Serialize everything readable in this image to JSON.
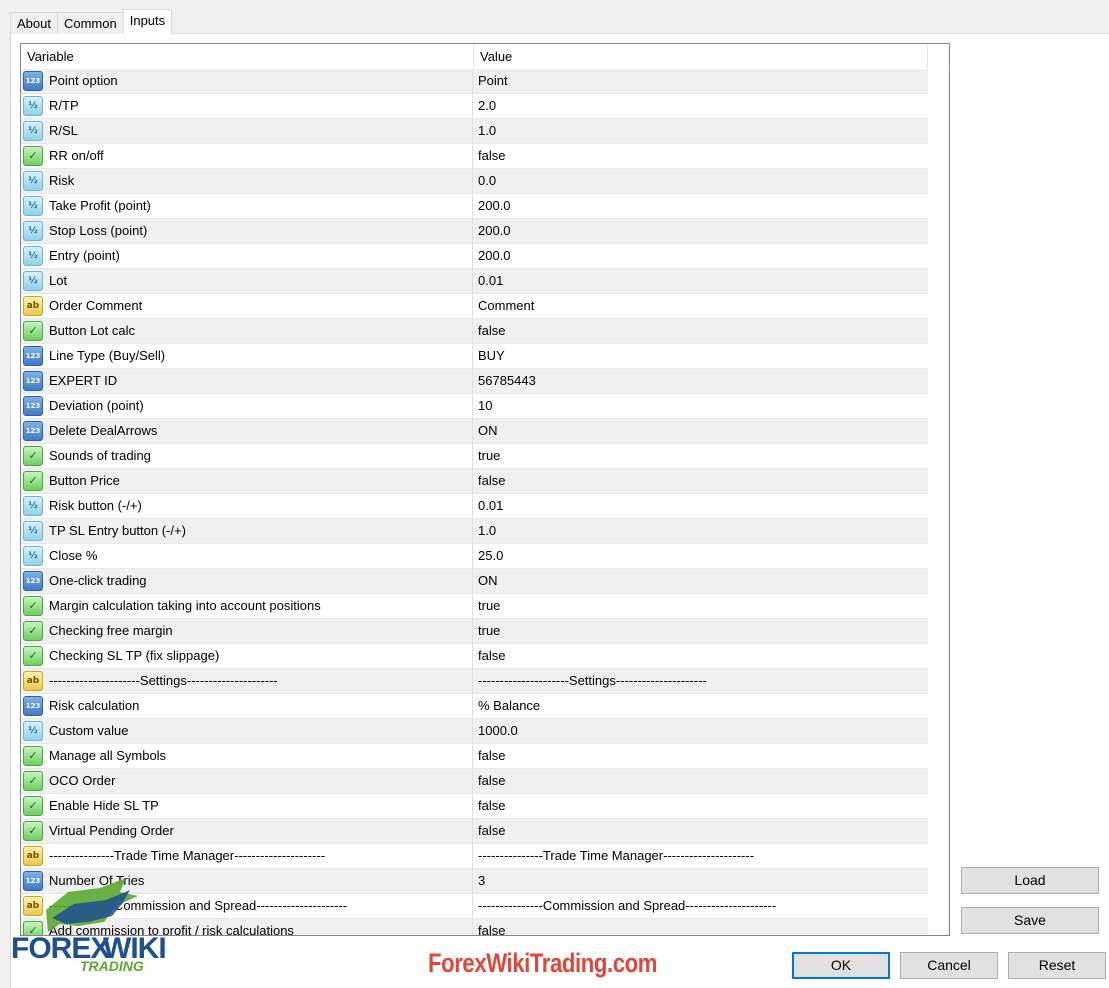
{
  "tabs": [
    {
      "label": "About",
      "active": false
    },
    {
      "label": "Common",
      "active": false
    },
    {
      "label": "Inputs",
      "active": true
    }
  ],
  "grid": {
    "col_variable": "Variable",
    "col_value": "Value",
    "rows": [
      {
        "type": "num",
        "name": "Point option",
        "value": "Point"
      },
      {
        "type": "dbl",
        "name": "R/TP",
        "value": "2.0"
      },
      {
        "type": "dbl",
        "name": "R/SL",
        "value": "1.0"
      },
      {
        "type": "bool",
        "name": "RR on/off",
        "value": "false"
      },
      {
        "type": "dbl",
        "name": "Risk",
        "value": "0.0"
      },
      {
        "type": "dbl",
        "name": "Take Profit (point)",
        "value": "200.0"
      },
      {
        "type": "dbl",
        "name": "Stop Loss (point)",
        "value": "200.0"
      },
      {
        "type": "dbl",
        "name": "Entry (point)",
        "value": "200.0"
      },
      {
        "type": "dbl",
        "name": "Lot",
        "value": "0.01"
      },
      {
        "type": "str",
        "name": "Order Comment",
        "value": "Comment"
      },
      {
        "type": "bool",
        "name": "Button Lot calc",
        "value": "false"
      },
      {
        "type": "num",
        "name": "Line Type (Buy/Sell)",
        "value": "BUY"
      },
      {
        "type": "num",
        "name": "EXPERT ID",
        "value": "56785443"
      },
      {
        "type": "num",
        "name": "Deviation (point)",
        "value": "10"
      },
      {
        "type": "num",
        "name": "Delete DealArrows",
        "value": "ON"
      },
      {
        "type": "bool",
        "name": "Sounds of trading",
        "value": "true"
      },
      {
        "type": "bool",
        "name": "Button Price",
        "value": "false"
      },
      {
        "type": "dbl",
        "name": "Risk button (-/+)",
        "value": "0.01"
      },
      {
        "type": "dbl",
        "name": "TP SL Entry button (-/+)",
        "value": "1.0"
      },
      {
        "type": "dbl",
        "name": "Close %",
        "value": "25.0"
      },
      {
        "type": "num",
        "name": "One-click trading",
        "value": "ON"
      },
      {
        "type": "bool",
        "name": "Margin calculation taking into account positions",
        "value": "true"
      },
      {
        "type": "bool",
        "name": "Checking free margin",
        "value": "true"
      },
      {
        "type": "bool",
        "name": "Checking SL TP (fix slippage)",
        "value": "false"
      },
      {
        "type": "str",
        "name": "---------------------Settings---------------------",
        "value": "---------------------Settings---------------------"
      },
      {
        "type": "num",
        "name": "Risk calculation",
        "value": "% Balance"
      },
      {
        "type": "dbl",
        "name": "Custom value",
        "value": "1000.0"
      },
      {
        "type": "bool",
        "name": "Manage all Symbols",
        "value": "false"
      },
      {
        "type": "bool",
        "name": "OCO Order",
        "value": "false"
      },
      {
        "type": "bool",
        "name": "Enable Hide SL TP",
        "value": "false"
      },
      {
        "type": "bool",
        "name": "Virtual Pending Order",
        "value": "false"
      },
      {
        "type": "str",
        "name": "---------------Trade Time Manager---------------------",
        "value": "---------------Trade Time Manager---------------------"
      },
      {
        "type": "num",
        "name": "Number Of Tries",
        "value": "3"
      },
      {
        "type": "str",
        "name": "---------------Commission and Spread---------------------",
        "value": "---------------Commission and Spread---------------------"
      },
      {
        "type": "bool",
        "name": "Add commission to profit / risk calculations",
        "value": "false"
      }
    ]
  },
  "icons": {
    "num": "123",
    "dbl": "½",
    "bool": "✓",
    "str": "ab"
  },
  "buttons": {
    "load": "Load",
    "save": "Save",
    "ok": "OK",
    "cancel": "Cancel",
    "reset": "Reset"
  },
  "branding": {
    "logo_forex": "FOREX",
    "logo_wiki": "WIKI",
    "logo_trading": "TRADING",
    "watermark_url": "ForexWikiTrading.com"
  },
  "colors": {
    "accent": "#0078d7",
    "watermark": "#e0473a",
    "logo_blue": "#1d4f91",
    "logo_green": "#5aa832"
  }
}
